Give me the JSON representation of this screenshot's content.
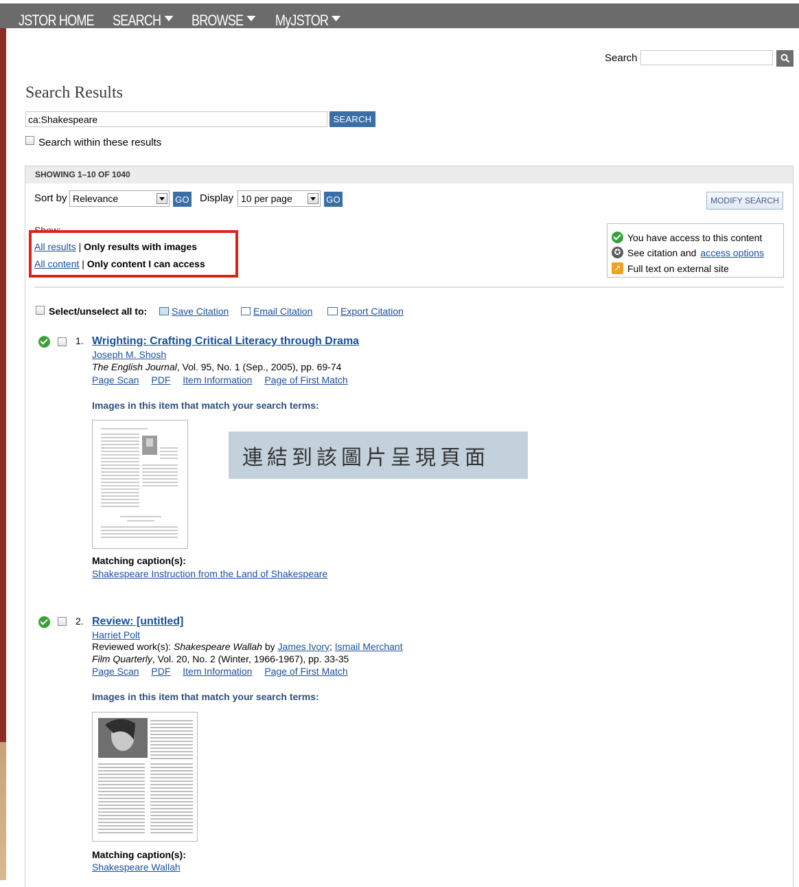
{
  "nav": {
    "items": [
      "JSTOR HOME",
      "SEARCH",
      "BROWSE",
      "MyJSTOR"
    ]
  },
  "header_search": {
    "label": "Search",
    "value": ""
  },
  "page_title": "Search Results",
  "query": {
    "value": "ca:Shakespeare",
    "button": "SEARCH"
  },
  "search_within_label": "Search within these results",
  "showing": "SHOWING 1–10 OF 1040",
  "sort": {
    "label": "Sort by",
    "value": "Relevance",
    "go": "GO"
  },
  "display": {
    "label": "Display",
    "value": "10 per page",
    "go": "GO"
  },
  "modify_search": "MODIFY SEARCH",
  "show_label": "Show:",
  "filters": {
    "results_link": "All results",
    "results_active": "Only results with images",
    "content_link": "All content",
    "content_active": "Only content I can access",
    "separator": "|"
  },
  "legend": {
    "access": "You have access to this content",
    "citation_prefix": "See citation and",
    "citation_link": "access options",
    "external": "Full text on external site"
  },
  "select_all_label": "Select/unselect all to:",
  "citation_actions": [
    "Save Citation",
    "Email Citation",
    "Export Citation"
  ],
  "results": [
    {
      "number": "1.",
      "title": "Wrighting: Crafting Critical Literacy through Drama",
      "author": "Joseph M. Shosh",
      "journal": "The English Journal",
      "details": ", Vol. 95, No. 1 (Sep., 2005), pp. 69-74",
      "links": [
        "Page Scan",
        "PDF",
        "Item Information",
        "Page of First Match"
      ],
      "images_heading": "Images in this item that match your search terms:",
      "caption_heading": "Matching caption(s):",
      "caption": "Shakespeare Instruction from the Land of Shakespeare"
    },
    {
      "number": "2.",
      "title": "Review: [untitled]",
      "author": "Harriet Polt",
      "reviewed_prefix": "Reviewed work(s): ",
      "reviewed_work": "Shakespeare Wallah",
      "reviewed_by": " by ",
      "reviewed_authors": [
        "James Ivory",
        "Ismail Merchant"
      ],
      "journal": "Film Quarterly",
      "details": ", Vol. 20, No. 2 (Winter, 1966-1967), pp. 33-35",
      "links": [
        "Page Scan",
        "PDF",
        "Item Information",
        "Page of First Match"
      ],
      "images_heading": "Images in this item that match your search terms:",
      "caption_heading": "Matching caption(s):",
      "caption": "Shakespeare Wallah"
    }
  ],
  "annotation": "連結到該圖片呈現頁面",
  "colors": {
    "nav_bg": "#6b6b6b",
    "link": "#1a4f9c",
    "button": "#3a6fa6",
    "highlight_box": "#e0201b",
    "annotation_bg": "#c3d1dd"
  }
}
